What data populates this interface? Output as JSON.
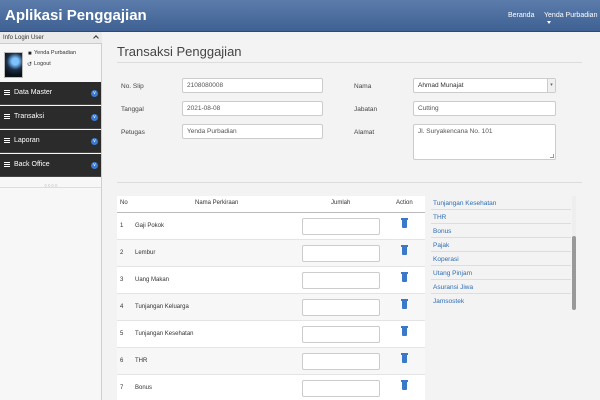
{
  "app": {
    "title": "Aplikasi Penggajian"
  },
  "topnav": {
    "home_label": "Beranda",
    "user_label": "Yenda Purbadian"
  },
  "sidebar": {
    "login_header": "Info Login User",
    "user_name": "Yenda Purbadian",
    "logout_label": "Logout",
    "items": [
      {
        "label": "Data Master"
      },
      {
        "label": "Transaksi"
      },
      {
        "label": "Laporan"
      },
      {
        "label": "Back Office"
      }
    ],
    "grip": "○○○○"
  },
  "page": {
    "title": "Transaksi Penggajian"
  },
  "form": {
    "no_slip_label": "No. Slip",
    "no_slip_value": "2108080008",
    "tanggal_label": "Tanggal",
    "tanggal_value": "2021-08-08",
    "petugas_label": "Petugas",
    "petugas_value": "Yenda Purbadian",
    "nama_label": "Nama",
    "nama_value": "Ahmad Munajat",
    "jabatan_label": "Jabatan",
    "jabatan_value": "Cutting",
    "alamat_label": "Alamat",
    "alamat_value": "Jl. Suryakencana No. 101"
  },
  "table": {
    "headers": {
      "no": "No",
      "nama": "Nama Perkiraan",
      "jumlah": "Jumlah",
      "action": "Action"
    },
    "rows": [
      {
        "no": "1",
        "name": "Gaji Pokok"
      },
      {
        "no": "2",
        "name": "Lembur"
      },
      {
        "no": "3",
        "name": "Uang Makan"
      },
      {
        "no": "4",
        "name": "Tunjangan Keluarga"
      },
      {
        "no": "5",
        "name": "Tunjangan Kesehatan"
      },
      {
        "no": "6",
        "name": "THR"
      },
      {
        "no": "7",
        "name": "Bonus"
      }
    ]
  },
  "picklist": {
    "items": [
      "Tunjangan Kesehatan",
      "THR",
      "Bonus",
      "Pajak",
      "Koperasi",
      "Utang Pinjam",
      "Asuransi Jiwa",
      "Jamsostek"
    ]
  },
  "colors": {
    "topbar": "#3f6193",
    "sidebar_menu": "#2b2b2b",
    "link": "#2e6db5",
    "trash_icon": "#3a78c9"
  }
}
